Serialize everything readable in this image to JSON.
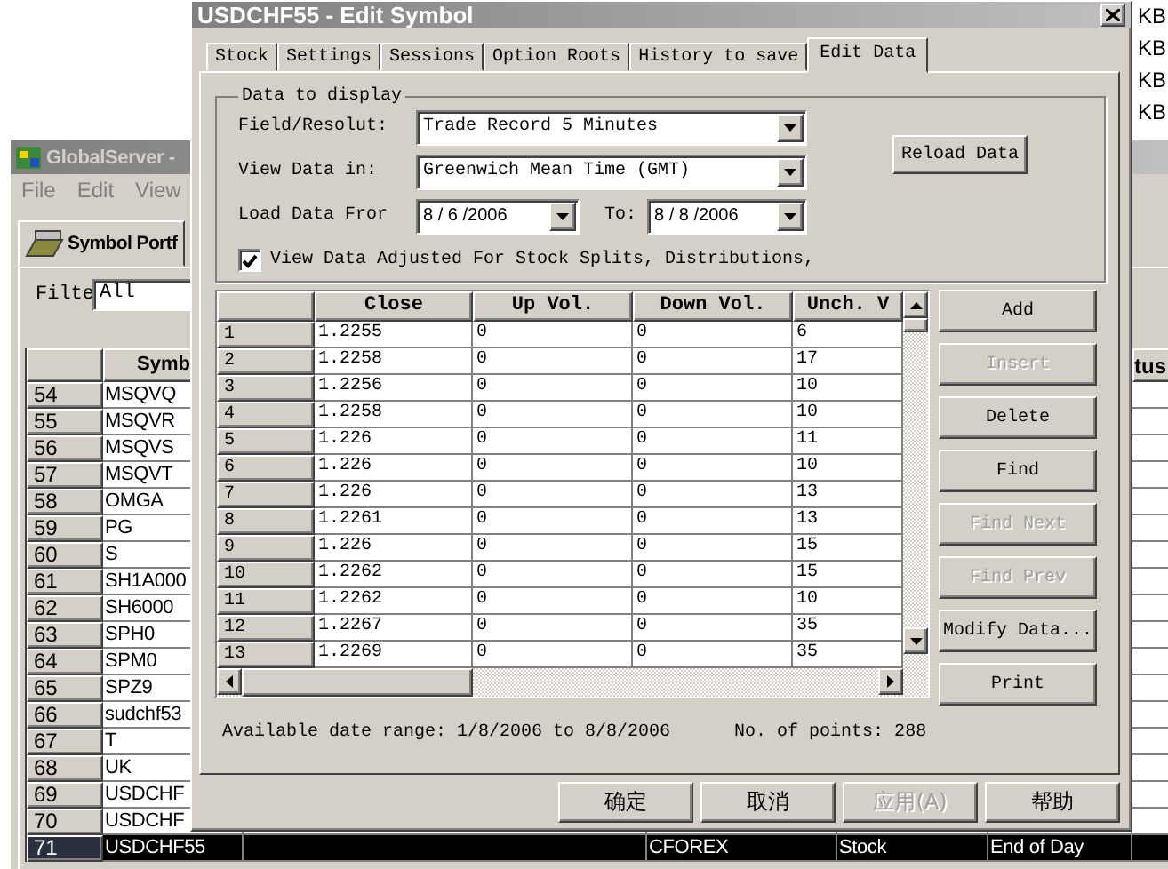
{
  "side_labels": [
    "KB",
    "KB",
    "KB",
    "KB"
  ],
  "main_window": {
    "title": "GlobalServer -",
    "menu": [
      "File",
      "Edit",
      "View"
    ],
    "tab": "Symbol Portf",
    "filter": {
      "label": "Filte",
      "value": "All"
    },
    "table": {
      "columns": [
        "Symb",
        "tus"
      ],
      "rows": [
        {
          "number": "54",
          "symbol": "MSQVQ",
          "selected": false
        },
        {
          "number": "55",
          "symbol": "MSQVR",
          "selected": false
        },
        {
          "number": "56",
          "symbol": "MSQVS",
          "selected": false
        },
        {
          "number": "57",
          "symbol": "MSQVT",
          "selected": false
        },
        {
          "number": "58",
          "symbol": "OMGA",
          "selected": false
        },
        {
          "number": "59",
          "symbol": "PG",
          "selected": false
        },
        {
          "number": "60",
          "symbol": "S",
          "selected": false
        },
        {
          "number": "61",
          "symbol": "SH1A000",
          "selected": false
        },
        {
          "number": "62",
          "symbol": "SH6000",
          "selected": false
        },
        {
          "number": "63",
          "symbol": "SPH0",
          "selected": false
        },
        {
          "number": "64",
          "symbol": "SPM0",
          "selected": false
        },
        {
          "number": "65",
          "symbol": "SPZ9",
          "selected": false
        },
        {
          "number": "66",
          "symbol": "sudchf53",
          "selected": false
        },
        {
          "number": "67",
          "symbol": "T",
          "selected": false
        },
        {
          "number": "68",
          "symbol": "UK",
          "selected": false
        },
        {
          "number": "69",
          "symbol": "USDCHF",
          "selected": false
        },
        {
          "number": "70",
          "symbol": "USDCHF",
          "selected": false
        },
        {
          "number": "71",
          "symbol": "USDCHF55",
          "column_3": "CFOREX",
          "column_4": "Stock",
          "column_5": "End of Day",
          "selected": true
        }
      ]
    }
  },
  "dialog": {
    "title": "USDCHF55 - Edit Symbol",
    "tabs": [
      {
        "label": "Stock",
        "selected": false
      },
      {
        "label": "Settings",
        "selected": false
      },
      {
        "label": "Sessions",
        "selected": false
      },
      {
        "label": "Option Roots",
        "selected": false
      },
      {
        "label": "History to save",
        "selected": false
      },
      {
        "label": "Edit Data",
        "selected": true
      }
    ],
    "group_title": "Data to display",
    "field_resolution": {
      "label": "Field/Resolut:",
      "value": "Trade Record 5 Minutes"
    },
    "view_data_in": {
      "label": "View Data in:",
      "value": "Greenwich Mean Time (GMT)"
    },
    "load_from": {
      "label": "Load Data Fror",
      "value": "8 / 6 /2006"
    },
    "load_to": {
      "label": "To:",
      "value": "8 / 8 /2006"
    },
    "reload_button": "Reload Data",
    "adjust_checkbox": {
      "label": "View Data Adjusted For Stock Splits, Distributions,",
      "checked": true
    },
    "grid": {
      "columns": [
        "Close",
        "Up Vol.",
        "Down Vol.",
        "Unch. V"
      ],
      "rows": [
        {
          "number": "1",
          "cells": [
            "1.2255",
            "0",
            "0",
            "6"
          ]
        },
        {
          "number": "2",
          "cells": [
            "1.2258",
            "0",
            "0",
            "17"
          ]
        },
        {
          "number": "3",
          "cells": [
            "1.2256",
            "0",
            "0",
            "10"
          ]
        },
        {
          "number": "4",
          "cells": [
            "1.2258",
            "0",
            "0",
            "10"
          ]
        },
        {
          "number": "5",
          "cells": [
            "1.226",
            "0",
            "0",
            "11"
          ]
        },
        {
          "number": "6",
          "cells": [
            "1.226",
            "0",
            "0",
            "10"
          ]
        },
        {
          "number": "7",
          "cells": [
            "1.226",
            "0",
            "0",
            "13"
          ]
        },
        {
          "number": "8",
          "cells": [
            "1.2261",
            "0",
            "0",
            "13"
          ]
        },
        {
          "number": "9",
          "cells": [
            "1.226",
            "0",
            "0",
            "15"
          ]
        },
        {
          "number": "10",
          "cells": [
            "1.2262",
            "0",
            "0",
            "15"
          ]
        },
        {
          "number": "11",
          "cells": [
            "1.2262",
            "0",
            "0",
            "10"
          ]
        },
        {
          "number": "12",
          "cells": [
            "1.2267",
            "0",
            "0",
            "35"
          ]
        },
        {
          "number": "13",
          "cells": [
            "1.2269",
            "0",
            "0",
            "35"
          ]
        }
      ]
    },
    "side_buttons": [
      {
        "label": "Add",
        "disabled": false
      },
      {
        "label": "Insert",
        "disabled": true
      },
      {
        "label": "Delete",
        "disabled": false
      },
      {
        "label": "Find",
        "disabled": false
      },
      {
        "label": "Find Next",
        "disabled": true
      },
      {
        "label": "Find Prev",
        "disabled": true
      },
      {
        "label": "Modify Data...",
        "disabled": false
      },
      {
        "label": "Print",
        "disabled": false
      }
    ],
    "date_range": "Available date range: 1/8/2006 to 8/8/2006",
    "points": "No. of points: 288",
    "footer_buttons": [
      {
        "label": "确定",
        "disabled": false
      },
      {
        "label": "取消",
        "disabled": false
      },
      {
        "label": "应用(A)",
        "disabled": true
      },
      {
        "label": "帮助",
        "disabled": false
      }
    ]
  }
}
